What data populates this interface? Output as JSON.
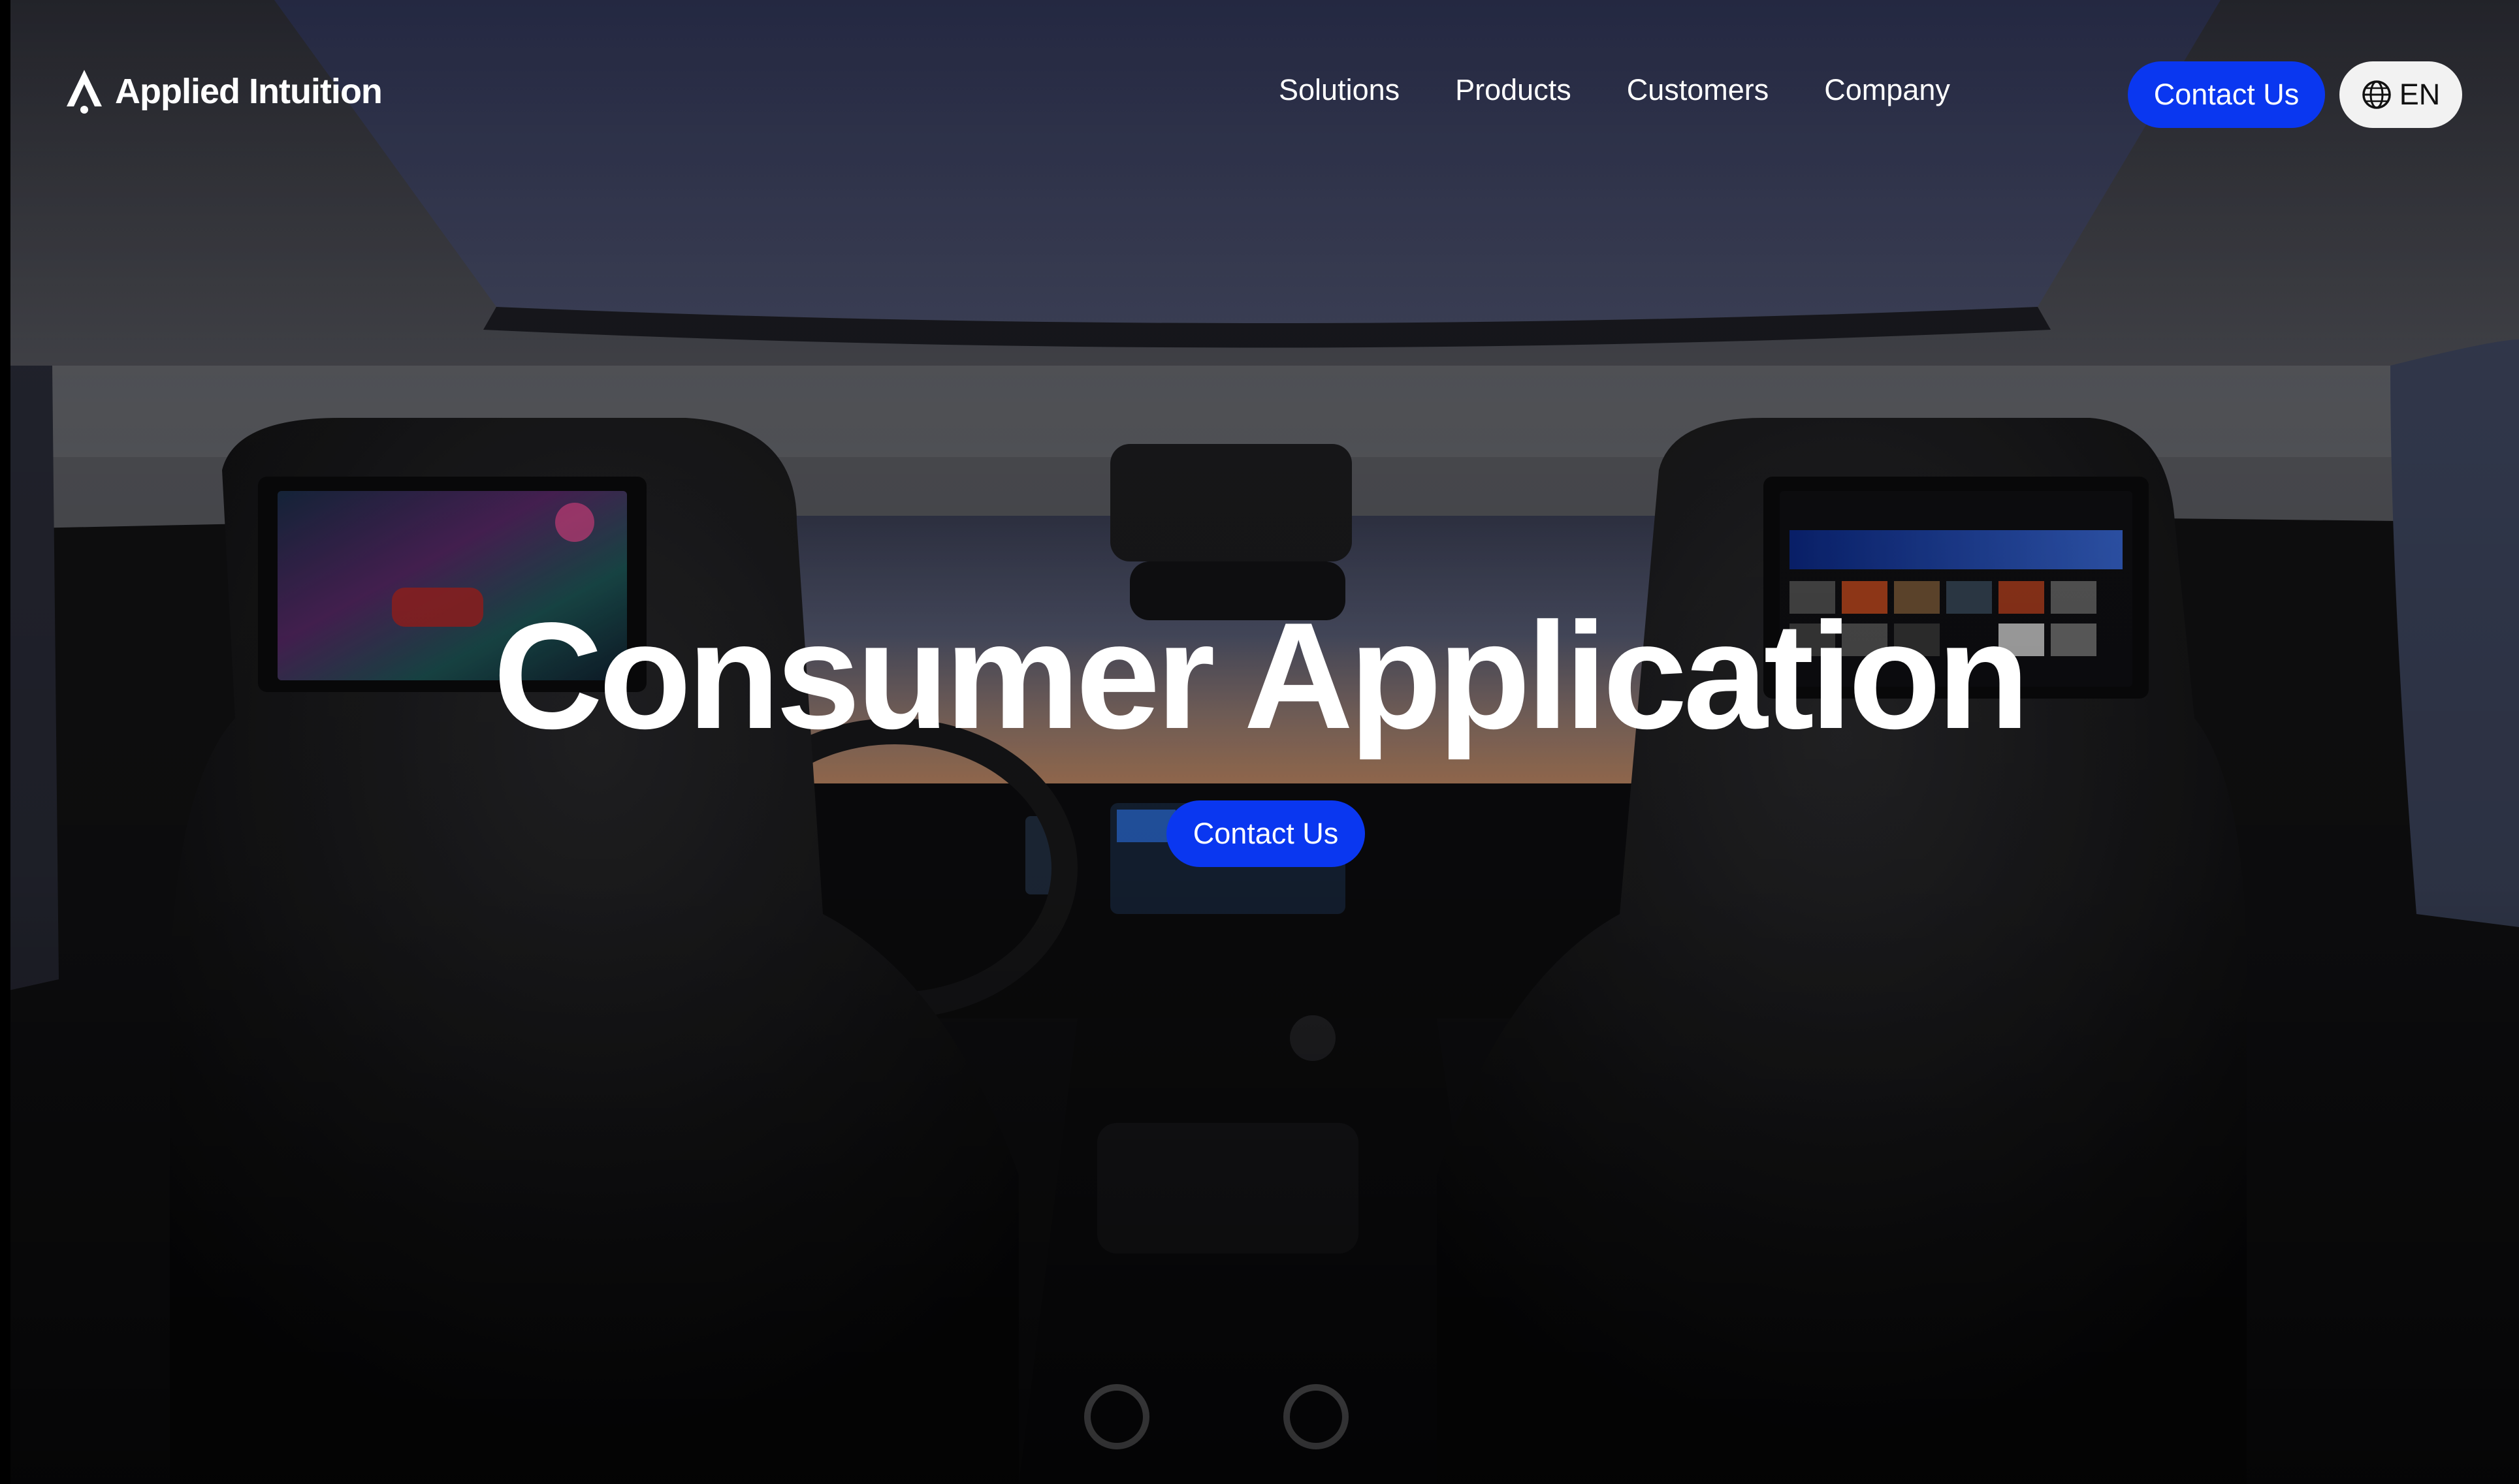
{
  "brand": {
    "name": "Applied Intuition",
    "logo_icon": "applied-intuition-logo-icon"
  },
  "nav": {
    "items": [
      {
        "label": "Solutions"
      },
      {
        "label": "Products"
      },
      {
        "label": "Customers"
      },
      {
        "label": "Company"
      }
    ],
    "contact_label": "Contact Us",
    "language_label": "EN",
    "language_icon": "globe-icon"
  },
  "hero": {
    "title": "Consumer Application",
    "cta_label": "Contact Us",
    "background": "car-interior-photo"
  },
  "colors": {
    "accent": "#0a37f0",
    "text": "#ffffff",
    "lang_bg": "#f2f2f2"
  }
}
